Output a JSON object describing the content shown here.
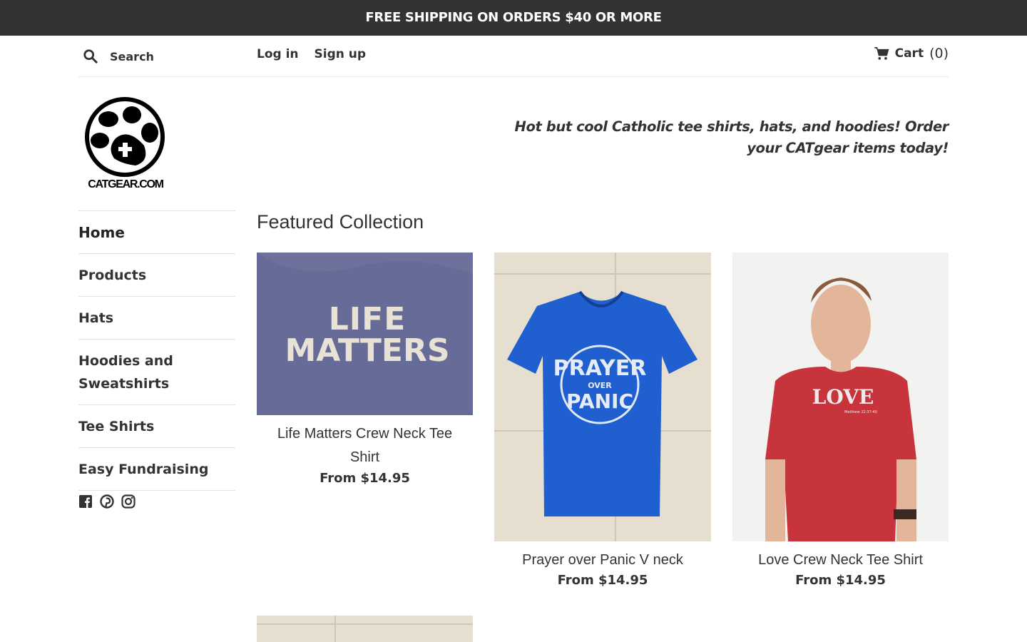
{
  "announcement": "FREE SHIPPING ON ORDERS $40 OR MORE",
  "header": {
    "search_placeholder": "Search",
    "login_label": "Log in",
    "signup_label": "Sign up",
    "cart_label": "Cart",
    "cart_count": "(0)"
  },
  "brand": {
    "logo_text": "CATGEAR.COM",
    "tagline": "Hot but cool Catholic tee shirts, hats, and hoodies! Order your CATgear items today!"
  },
  "nav": {
    "items": [
      {
        "label": "Home"
      },
      {
        "label": "Products"
      },
      {
        "label": "Hats"
      },
      {
        "label": "Hoodies and Sweatshirts"
      },
      {
        "label": "Tee Shirts"
      },
      {
        "label": "Easy Fundraising"
      }
    ],
    "social_icons": [
      "facebook-icon",
      "pinterest-icon",
      "instagram-icon"
    ]
  },
  "featured": {
    "title": "Featured Collection",
    "products": [
      {
        "title": "Life Matters Crew Neck Tee Shirt",
        "price": "From $14.95",
        "shirt_text_line1": "LIFE",
        "shirt_text_line2": "MATTERS",
        "image_color": "#6a6e9a"
      },
      {
        "title": "Prayer over Panic V neck",
        "price": "From $14.95",
        "shirt_text_line1": "PRAYER",
        "shirt_text_line2": "OVER",
        "shirt_text_line3": "PANIC",
        "image_color": "#1f5fd0"
      },
      {
        "title": "Love Crew Neck Tee Shirt",
        "price": "From $14.95",
        "shirt_text_line1": "LOVE",
        "shirt_text_line2": "Matthew 22:37-40",
        "image_color": "#c8343c"
      }
    ]
  },
  "colors": {
    "bar": "#333333",
    "text": "#333333",
    "divider": "#e2e2e2"
  }
}
